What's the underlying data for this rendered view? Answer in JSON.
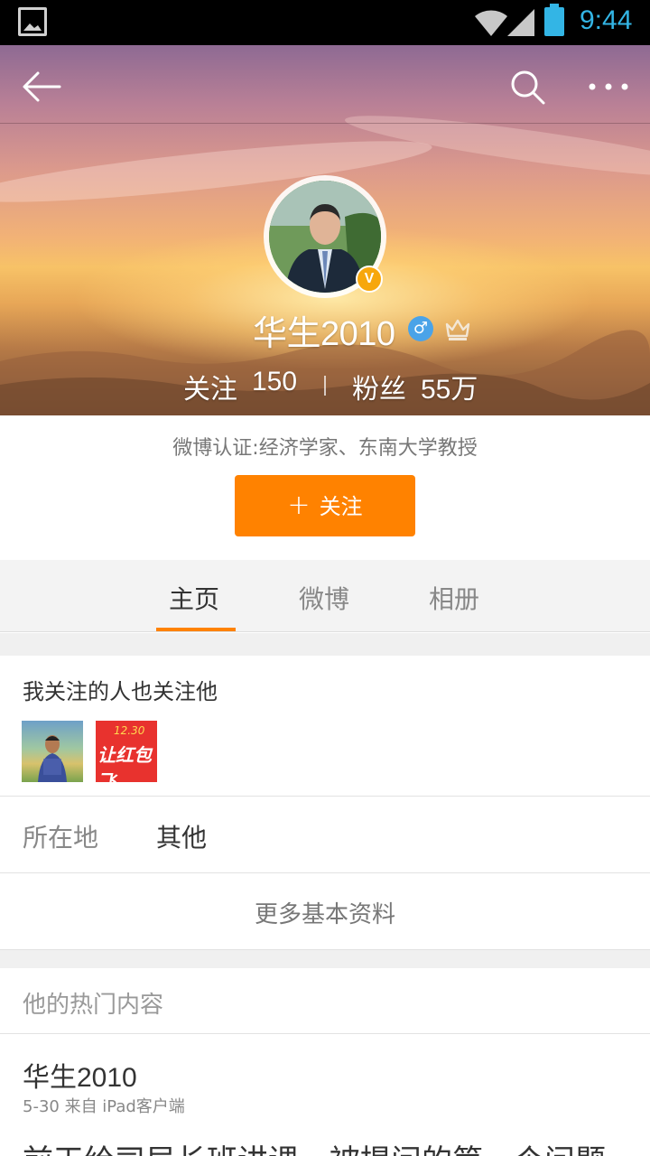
{
  "status_bar": {
    "time": "9:44"
  },
  "header": {
    "username": "华生2010",
    "gender_symbol": "♂",
    "verified_badge": "V",
    "stats": {
      "following_label": "关注",
      "following_value": "150",
      "fans_label": "粉丝",
      "fans_value": "55万"
    }
  },
  "profile": {
    "verification": "微博认证:经济学家、东南大学教授",
    "follow_button": {
      "icon": "+",
      "label": "关注"
    }
  },
  "tabs": [
    {
      "label": "主页",
      "active": true
    },
    {
      "label": "微博",
      "active": false
    },
    {
      "label": "相册",
      "active": false
    }
  ],
  "mutual": {
    "title": "我关注的人也关注他",
    "avatar2_texts": [
      "12.30",
      "让红包飞"
    ]
  },
  "location": {
    "label": "所在地",
    "value": "其他"
  },
  "more_info_label": "更多基本资料",
  "hot_content": {
    "title": "他的热门内容",
    "post": {
      "author": "华生2010",
      "meta": "5-30  来自 iPad客户端",
      "text": "前天给司局长班讲课，被提问的第一个问题"
    }
  },
  "colors": {
    "accent": "#ff8200",
    "status_blue": "#33b5e5",
    "verified_gold": "#f7a70d"
  }
}
